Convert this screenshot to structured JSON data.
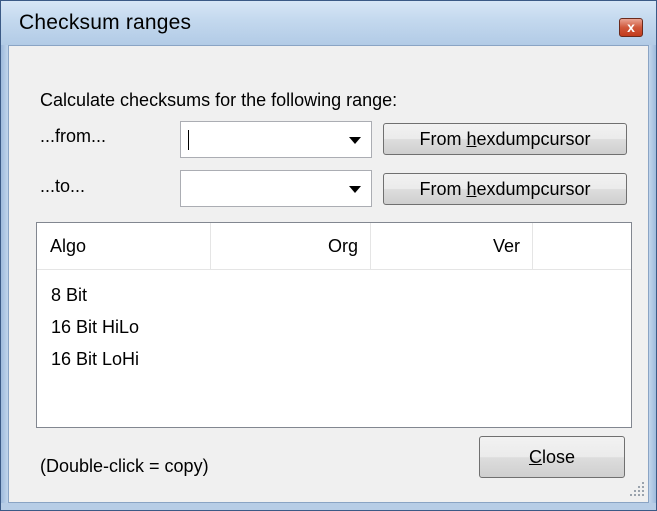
{
  "window": {
    "title": "Checksum ranges",
    "close_glyph": "x"
  },
  "form": {
    "intro": "Calculate checksums for the following range:",
    "from_label": "...from...",
    "to_label": "...to...",
    "from_value": "",
    "to_value": "",
    "from_button": {
      "pre": "From ",
      "accel": "h",
      "post": "exdumpcursor"
    },
    "to_button": {
      "pre": "From ",
      "accel": "h",
      "post": "exdumpcursor"
    }
  },
  "list": {
    "columns": [
      "Algo",
      "Org",
      "Ver"
    ],
    "rows": [
      {
        "algo": "8 Bit",
        "org": "",
        "ver": ""
      },
      {
        "algo": "16 Bit HiLo",
        "org": "",
        "ver": ""
      },
      {
        "algo": "16 Bit LoHi",
        "org": "",
        "ver": ""
      }
    ]
  },
  "footer": {
    "hint": "(Double-click = copy)",
    "close_button": {
      "accel": "C",
      "post": "lose"
    }
  },
  "colors": {
    "title_bar": "#c3d8ee",
    "client_bg": "#f0f0f0",
    "close_btn": "#d0573a"
  },
  "icons": {
    "close": "close-icon",
    "dropdown": "chevron-down-icon",
    "resize": "resize-grip-icon"
  }
}
